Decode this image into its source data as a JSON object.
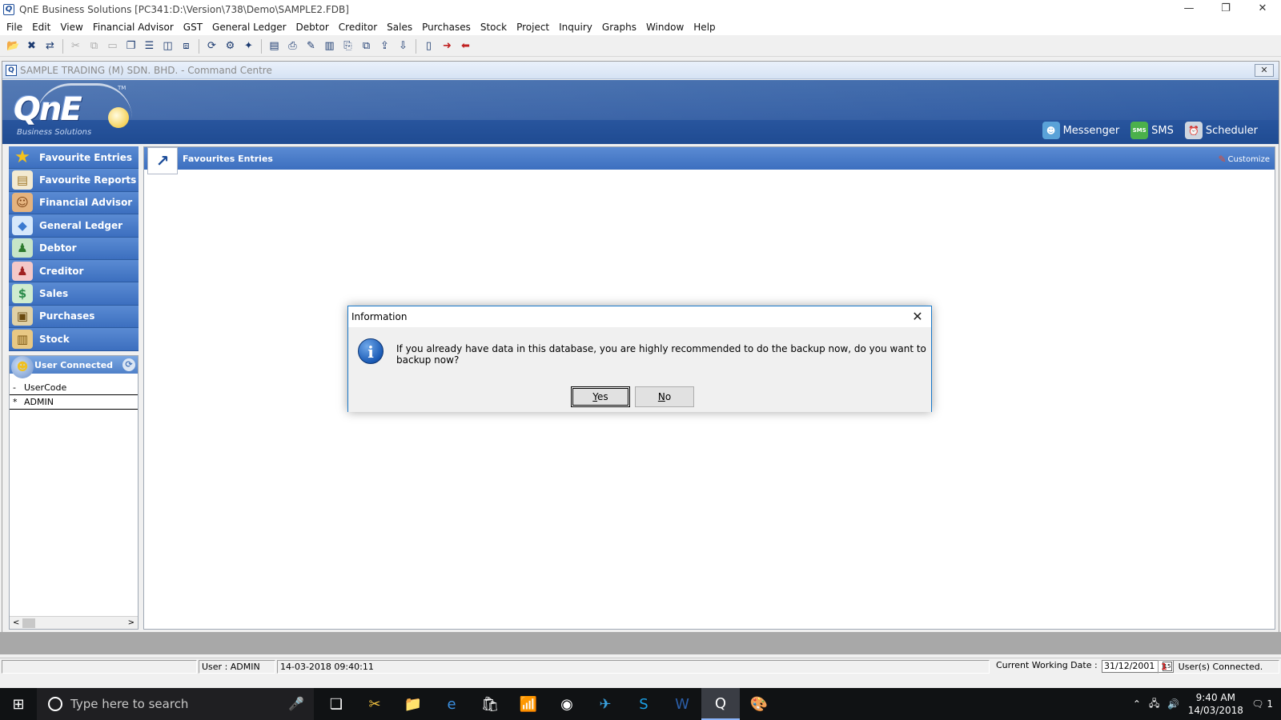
{
  "window": {
    "title": "QnE Business Solutions [PC341:D:\\Version\\738\\Demo\\SAMPLE2.FDB]",
    "controls": [
      "—",
      "❐",
      "✕"
    ]
  },
  "menubar": [
    "File",
    "Edit",
    "View",
    "Financial Advisor",
    "GST",
    "General Ledger",
    "Debtor",
    "Creditor",
    "Sales",
    "Purchases",
    "Stock",
    "Project",
    "Inquiry",
    "Graphs",
    "Window",
    "Help"
  ],
  "child_window": {
    "title": "SAMPLE TRADING (M) SDN. BHD. - Command Centre",
    "close": "✕"
  },
  "logo": {
    "brand": "QnE",
    "sub": "Business Solutions",
    "tm": "TM"
  },
  "banner_links": {
    "messenger": "Messenger",
    "sms": "SMS",
    "sms_icon": "SMS",
    "scheduler": "Scheduler"
  },
  "nav": [
    {
      "label": "Favourite Entries",
      "icon": "★"
    },
    {
      "label": "Favourite Reports",
      "icon": "▤"
    },
    {
      "label": "Financial Advisor",
      "icon": "☺"
    },
    {
      "label": "General Ledger",
      "icon": "◆"
    },
    {
      "label": "Debtor",
      "icon": "♟"
    },
    {
      "label": "Creditor",
      "icon": "♟"
    },
    {
      "label": "Sales",
      "icon": "$"
    },
    {
      "label": "Purchases",
      "icon": "▣"
    },
    {
      "label": "Stock",
      "icon": "▥"
    }
  ],
  "user_connected": {
    "title": "User Connected",
    "rows": [
      {
        "marker": "-",
        "value": "UserCode"
      },
      {
        "marker": "*",
        "value": "ADMIN"
      }
    ]
  },
  "main": {
    "title": "Favourites Entries",
    "customize": "Customize"
  },
  "dialog": {
    "title": "Information",
    "message": "If you already have data in this database, you are highly recommended to do the backup now, do you want to backup now?",
    "yes_accel": "Y",
    "yes_rest": "es",
    "no_accel": "N",
    "no_rest": "o"
  },
  "statusbar": {
    "user": "User : ADMIN",
    "timestamp": "14-03-2018 09:40:11",
    "working_date_label": "Current Working Date :",
    "working_date": "31/12/2001",
    "users_count": "1",
    "users_label": "User(s) Connected."
  },
  "taskbar": {
    "search_placeholder": "Type here to search",
    "time": "9:40 AM",
    "date": "14/03/2018",
    "notifications": "1"
  }
}
